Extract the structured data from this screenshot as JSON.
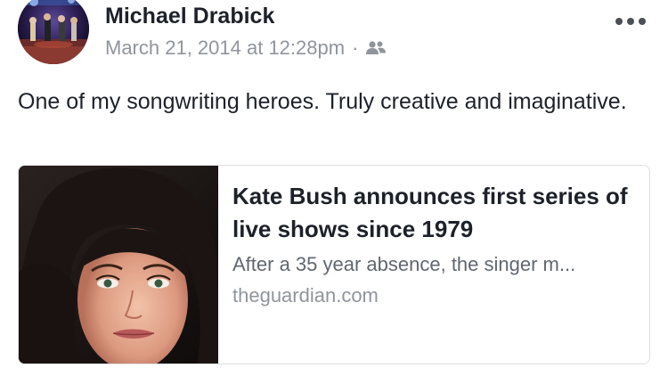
{
  "post": {
    "author": "Michael Drabick",
    "timestamp": "March 21, 2014 at 12:28pm",
    "separator": "·",
    "audience_icon": "friends-icon",
    "more_icon": "more-options-icon",
    "text": "One of my songwriting heroes. Truly creative and imaginative.",
    "avatar_icon": "concert-stage-avatar"
  },
  "link": {
    "title": "Kate Bush announces first series of live shows since 1979",
    "description": "After a 35 year absence, the singer m...",
    "domain": "theguardian.com",
    "thumbnail": "portrait-photo"
  },
  "colors": {
    "text_primary": "#1d2129",
    "text_secondary": "#90949c",
    "text_description": "#606770",
    "card_border": "#dddfe2"
  }
}
